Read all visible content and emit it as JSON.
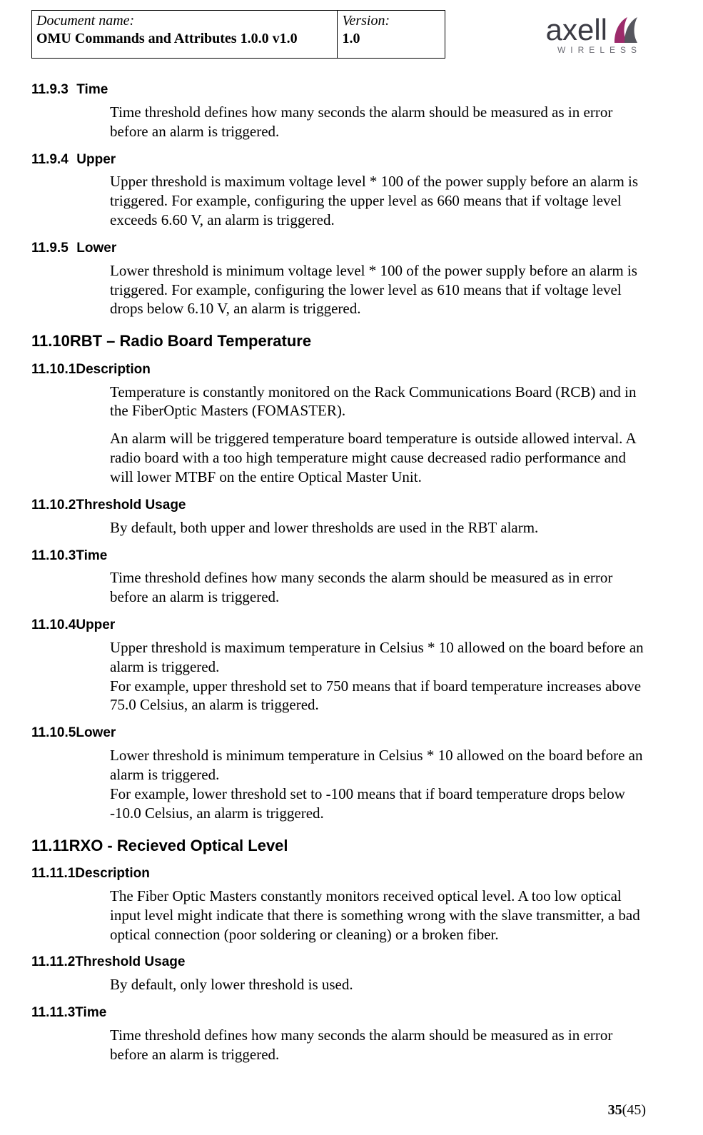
{
  "header": {
    "doc_name_label": "Document name:",
    "doc_name_value": "OMU Commands and Attributes 1.0.0 v1.0",
    "version_label": "Version:",
    "version_value": "1.0",
    "logo_text": "axell",
    "logo_sub": "WIRELESS"
  },
  "sections": {
    "s_11_9_3": {
      "num": "11.9.3",
      "title": "Time",
      "body": "Time threshold defines how many seconds the alarm should be measured as in error before an alarm is triggered."
    },
    "s_11_9_4": {
      "num": "11.9.4",
      "title": "Upper",
      "body": "Upper threshold is maximum voltage level * 100 of the power supply before an alarm is triggered. For example, configuring the upper level as 660 means that if voltage level exceeds 6.60 V, an alarm is triggered."
    },
    "s_11_9_5": {
      "num": "11.9.5",
      "title": "Lower",
      "body": "Lower threshold is minimum voltage level * 100 of the power supply before an alarm is triggered. For example, configuring the lower level as 610 means that if voltage level drops below 6.10 V, an alarm is triggered."
    },
    "s_11_10": {
      "num": "11.10",
      "title": "RBT – Radio Board Temperature"
    },
    "s_11_10_1": {
      "num": "11.10.1",
      "title": "Description",
      "body1": "Temperature is constantly monitored on the Rack Communications Board (RCB) and in the FiberOptic Masters (FOMASTER).",
      "body2": "An alarm will be triggered temperature board temperature is outside allowed interval. A radio board with a too high temperature might cause decreased radio performance and will lower MTBF on the entire Optical Master Unit."
    },
    "s_11_10_2": {
      "num": "11.10.2",
      "title": "Threshold Usage",
      "body": "By default, both upper and lower thresholds are used in the RBT alarm."
    },
    "s_11_10_3": {
      "num": "11.10.3",
      "title": "Time",
      "body": "Time threshold defines how many seconds the alarm should be measured as in error before an alarm is triggered."
    },
    "s_11_10_4": {
      "num": "11.10.4",
      "title": "Upper",
      "body1": "Upper threshold is maximum temperature in Celsius * 10 allowed on the board before an alarm is triggered.",
      "body2": "For example, upper threshold set to 750 means that if board temperature increases above 75.0 Celsius, an alarm is triggered."
    },
    "s_11_10_5": {
      "num": "11.10.5",
      "title": "Lower",
      "body1": "Lower threshold is minimum temperature in Celsius * 10 allowed on the board before an alarm is triggered.",
      "body2": "For example, lower threshold set to -100 means that if board temperature drops below -10.0 Celsius, an alarm is triggered."
    },
    "s_11_11": {
      "num": "11.11",
      "title": "RXO - Recieved Optical Level"
    },
    "s_11_11_1": {
      "num": "11.11.1",
      "title": "Description",
      "body": "The Fiber Optic Masters constantly monitors received optical level. A too low optical input level might indicate that there is something wrong with the slave transmitter, a bad optical connection (poor soldering or cleaning) or a broken fiber."
    },
    "s_11_11_2": {
      "num": "11.11.2",
      "title": "Threshold Usage",
      "body": "By default, only lower threshold is used."
    },
    "s_11_11_3": {
      "num": "11.11.3",
      "title": "Time",
      "body": "Time threshold defines how many seconds the alarm should be measured as in error before an alarm is triggered."
    }
  },
  "footer": {
    "page_current": "35",
    "page_total": "(45)"
  }
}
